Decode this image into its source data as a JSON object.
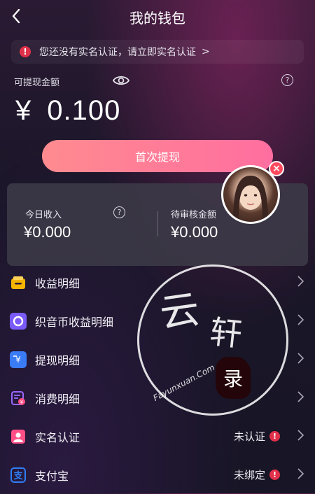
{
  "header": {
    "title": "我的钱包",
    "back_icon": "back-arrow-icon"
  },
  "notice": {
    "text": "您还没有实名认证，请立即实名认证",
    "chevron": ">"
  },
  "balance": {
    "label": "可提现金额",
    "currency": "¥",
    "amount": "0.100",
    "help": "?"
  },
  "withdraw_button": {
    "label": "首次提现"
  },
  "stats": {
    "today": {
      "label": "今日收入",
      "value": "¥0.000",
      "help": "?"
    },
    "pending": {
      "label": "待审核金额",
      "value": "¥0.000"
    }
  },
  "avatar": {
    "close": "×"
  },
  "menu": [
    {
      "label": "收益明细",
      "icon": "wallet-icon",
      "color": "#f5b400"
    },
    {
      "label": "织音币收益明细",
      "icon": "coin-icon",
      "color": "#7a5af8"
    },
    {
      "label": "提现明细",
      "icon": "withdraw-icon",
      "color": "#3a7bf6"
    },
    {
      "label": "消费明细",
      "icon": "bill-icon",
      "color": "#9a66ff"
    },
    {
      "label": "实名认证",
      "icon": "user-verify-icon",
      "color": "#ff4f86",
      "status": "未认证",
      "status_dot": "!"
    },
    {
      "label": "支付宝",
      "icon": "alipay-icon",
      "color": "#2f7ef7",
      "status": "未绑定",
      "status_dot": "!"
    }
  ],
  "watermark": {
    "text1": "云",
    "text2": "轩",
    "seal": "录",
    "sub": "Fayunxuan.Com"
  }
}
